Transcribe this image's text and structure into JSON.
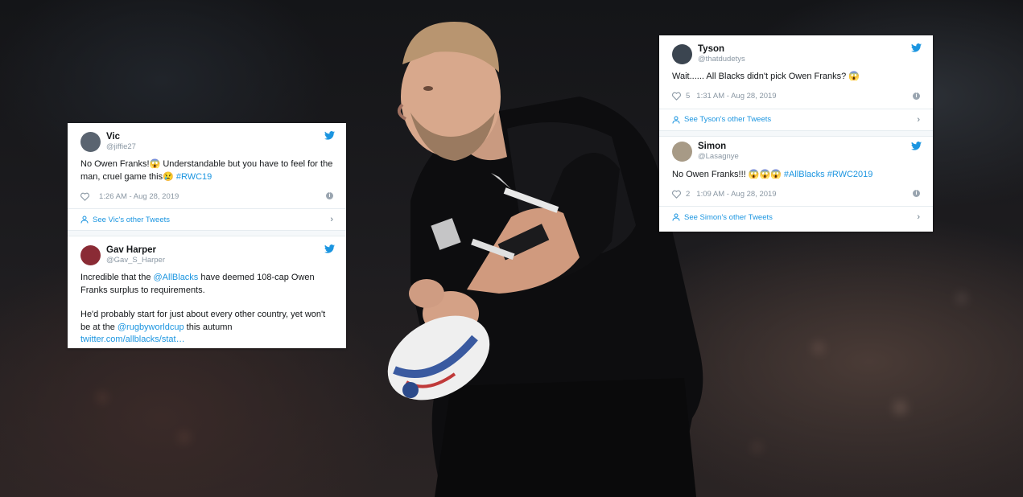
{
  "left_card": {
    "tweets": [
      {
        "name": "Vic",
        "handle": "@jiffie27",
        "text_plain": "No Owen Franks!😱 Understandable but you have to feel for the man, cruel game this😢 ",
        "hashtag": "#RWC19",
        "likes": "",
        "timestamp": "1:26 AM - Aug 28, 2019",
        "other_link": "See Vic's other Tweets",
        "avatar_color": "#5a6470"
      },
      {
        "name": "Gav Harper",
        "handle": "@Gav_S_Harper",
        "p1_before": "Incredible that the ",
        "p1_mention": "@AllBlacks",
        "p1_after": " have deemed 108-cap Owen Franks surplus to requirements.",
        "p2_before": "He'd probably start for just about every other country, yet won't be at the ",
        "p2_mention": "@rugbyworldcup",
        "p2_after": " this autumn",
        "link": "twitter.com/allblacks/stat…",
        "avatar_color": "#8a2b35"
      }
    ]
  },
  "right_card": {
    "tweets": [
      {
        "name": "Tyson",
        "handle": "@thatdudetys",
        "text_plain": "Wait...... All Blacks didn't pick Owen Franks? 😱",
        "likes": "5",
        "timestamp": "1:31 AM - Aug 28, 2019",
        "other_link": "See Tyson's other Tweets",
        "avatar_color": "#3b4550"
      },
      {
        "name": "Simon",
        "handle": "@Lasagnye",
        "text_plain": "No Owen Franks!!! 😱😱😱 ",
        "hashtags": "#AllBlacks #RWC2019",
        "likes": "2",
        "timestamp": "1:09 AM - Aug 28, 2019",
        "other_link": "See Simon's other Tweets",
        "avatar_color": "#a79a86"
      }
    ]
  },
  "colors": {
    "twitter_blue": "#1b95e0",
    "muted_text": "#8a97a3"
  },
  "icons": [
    "twitter-bird-icon",
    "heart-icon",
    "info-icon",
    "person-icon",
    "chevron-right-icon"
  ]
}
